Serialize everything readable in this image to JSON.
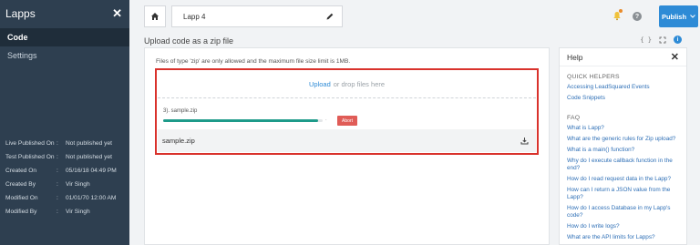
{
  "sidebar": {
    "title": "Lapps",
    "nav": [
      {
        "label": "Code",
        "active": true
      },
      {
        "label": "Settings",
        "active": false
      }
    ],
    "info": [
      {
        "key": "Live Published On",
        "value": "Not published yet"
      },
      {
        "key": "Test Published On",
        "value": "Not published yet"
      },
      {
        "key": "Created On",
        "value": "05/16/18 04:49 PM"
      },
      {
        "key": "Created By",
        "value": "Vir Singh"
      },
      {
        "key": "Modified On",
        "value": "01/01/70 12:00 AM"
      },
      {
        "key": "Modified By",
        "value": "Vir Singh"
      }
    ],
    "separator": ":"
  },
  "topbar": {
    "lapp_name": "Lapp 4",
    "publish_label": "Publish",
    "help_glyph": "?"
  },
  "upload": {
    "heading": "Upload code as a zip file",
    "note": "Files of type 'zip' are only allowed and the maximum file size limit is 1MB.",
    "dropzone_link": "Upload",
    "dropzone_text": "or drop files here",
    "progress_file": "3). sample.zip",
    "progress_fraction": 0.97,
    "abort_label": "Abort",
    "file_name": "sample.zip"
  },
  "help": {
    "title": "Help",
    "quick_title": "QUICK HELPERS",
    "quick_links": [
      "Accessing LeadSquared Events",
      "Code Snippets"
    ],
    "faq_title": "FAQ",
    "faq_links": [
      "What is Lapp?",
      "What are the generic rules for Zip upload?",
      "What is a main() function?",
      "Why do I execute callback function in the end?",
      "How do I read request data in the Lapp?",
      "How can I return a JSON value from the Lapp?",
      "How do I access Database in my Lapp's code?",
      "How do I write logs?",
      "What are the API limits for Lapps?"
    ]
  },
  "colors": {
    "sidebar_bg": "#2e3f50",
    "accent": "#2e8bd6",
    "highlight_border": "#d9322c",
    "progress": "#1e9b8a",
    "abort": "#e05c57"
  },
  "icons": [
    "close-icon",
    "home-icon",
    "pencil-icon",
    "bell-icon",
    "help-icon",
    "chevron-down-icon",
    "code-braces-icon",
    "expand-icon",
    "info-icon",
    "download-icon"
  ]
}
